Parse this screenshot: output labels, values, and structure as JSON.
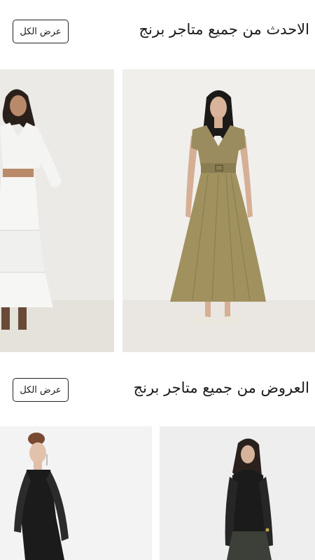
{
  "sections": [
    {
      "title": "الاحدث من جميع متاجر برنج",
      "view_all_label": "عرض الكل",
      "products": [
        {
          "image": "model-olive-wrap-midi-dress",
          "background": "#f1efec",
          "main_color": "#9a8c5e"
        },
        {
          "image": "model-white-cardigan-tiered-skirt",
          "background": "#eceae6",
          "main_color": "#f4f4f2"
        }
      ]
    },
    {
      "title": "العروض من جميع متاجر برنج",
      "view_all_label": "عرض الكل",
      "products": [
        {
          "image": "model-black-sheer-top",
          "background": "#f3f3f3",
          "main_color": "#1b1b1b"
        },
        {
          "image": "model-black-mesh-top-skirt",
          "background": "#eeeeee",
          "main_color": "#1b1b1b"
        }
      ]
    }
  ]
}
